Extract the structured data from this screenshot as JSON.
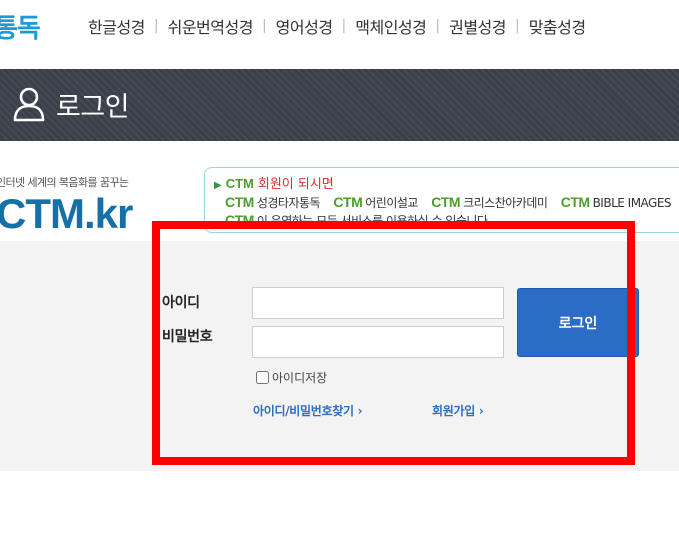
{
  "nav": {
    "logo": "통독",
    "items": [
      {
        "label": "한글성경"
      },
      {
        "label": "쉬운번역성경"
      },
      {
        "label": "영어성경"
      },
      {
        "label": "맥체인성경"
      },
      {
        "label": "권별성경"
      },
      {
        "label": "맞춤성경"
      }
    ]
  },
  "titlebar": {
    "title": "로그인",
    "icon": "user-icon"
  },
  "banner": {
    "tagline": "인터넷 세계의 복음화를 꿈꾸는",
    "logo": "CTM.kr",
    "notice": {
      "ctm": "CTM",
      "headline": "회원이 되시면",
      "services": [
        {
          "brand": "CTM",
          "name": "성경타자통독"
        },
        {
          "brand": "CTM",
          "name": "어린이설교"
        },
        {
          "brand": "CTM",
          "name": "크리스찬아카데미"
        },
        {
          "brand": "CTM",
          "name": "BIBLE IMAGES"
        }
      ],
      "footer_brand": "CTM",
      "footer_text": "이 운영하는 모든 서비스를 이용하실 수 있습니다."
    }
  },
  "login": {
    "id_label": "아이디",
    "pw_label": "비밀번호",
    "id_value": "",
    "pw_value": "",
    "button_label": "로그인",
    "save_id_label": "아이디저장",
    "save_id_checked": false,
    "find_link": "아이디/비밀번호찾기 ›",
    "signup_link": "회원가입 ›"
  },
  "colors": {
    "brand_blue": "#2a6cc6",
    "title_bar": "#3a3f4a",
    "ctm_green": "#4aa02a",
    "highlight_red": "#ff0000"
  }
}
